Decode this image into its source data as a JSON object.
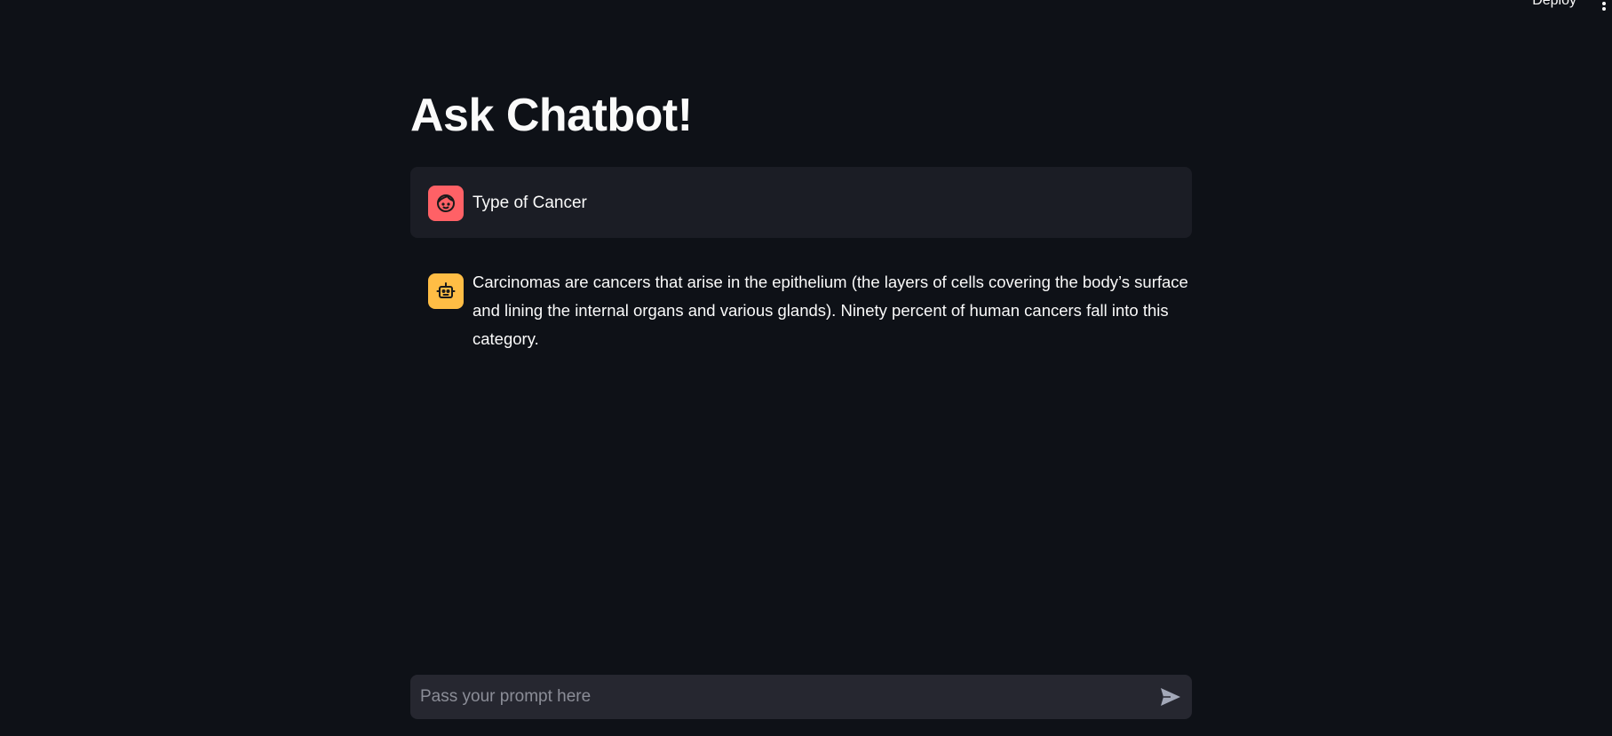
{
  "header": {
    "deploy_label": "Deploy",
    "menu_icon": "more-vertical-icon"
  },
  "main": {
    "title": "Ask Chatbot!"
  },
  "messages": [
    {
      "role": "user",
      "avatar_icon": "user-face-icon",
      "avatar_color": "#ff6166",
      "text": "Type of Cancer"
    },
    {
      "role": "assistant",
      "avatar_icon": "robot-icon",
      "avatar_color": "#ffbd45",
      "text": "Carcinomas are cancers that arise in the epithelium (the layers of cells covering the body’s surface and lining the internal organs and various glands). Ninety percent of human cancers fall into this category."
    }
  ],
  "chat_input": {
    "placeholder": "Pass your prompt here",
    "value": "",
    "send_icon": "send-icon"
  },
  "colors": {
    "background": "#0e1117",
    "user_message_bg": "#1b1d25",
    "input_bg": "#262730"
  }
}
